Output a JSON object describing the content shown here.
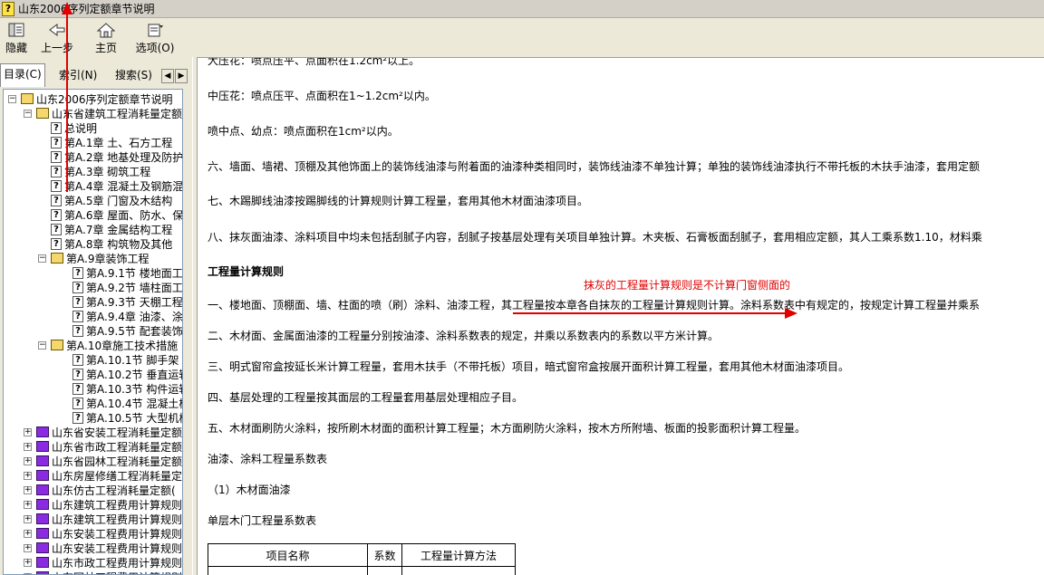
{
  "window": {
    "title": "山东2006序列定额章节说明",
    "app_icon_glyph": "?"
  },
  "toolbar": {
    "hide": "隐藏",
    "back": "上一步",
    "home": "主页",
    "options": "选项(O)"
  },
  "tabs": {
    "contents": "目录(C)",
    "index": "索引(N)",
    "search": "搜索(S)",
    "scroll_left": "◀",
    "scroll_right": "▶"
  },
  "tree": [
    {
      "label": "山东2006序列定额章节说明",
      "icon": "book-open",
      "expander": "−",
      "level": 0
    },
    {
      "label": "山东省建筑工程消耗量定额",
      "icon": "book-open",
      "expander": "−",
      "level": 1
    },
    {
      "label": "总说明",
      "icon": "help-page",
      "level": 2
    },
    {
      "label": "第A.1章 土、石方工程",
      "icon": "help-page",
      "level": 2
    },
    {
      "label": "第A.2章 地基处理及防护",
      "icon": "help-page",
      "level": 2
    },
    {
      "label": "第A.3章 砌筑工程",
      "icon": "help-page",
      "level": 2
    },
    {
      "label": "第A.4章 混凝土及钢筋混凝土",
      "icon": "help-page",
      "level": 2
    },
    {
      "label": "第A.5章 门窗及木结构",
      "icon": "help-page",
      "level": 2
    },
    {
      "label": "第A.6章 屋面、防水、保温",
      "icon": "help-page",
      "level": 2
    },
    {
      "label": "第A.7章 金属结构工程",
      "icon": "help-page",
      "level": 2
    },
    {
      "label": "第A.8章 构筑物及其他",
      "icon": "help-page",
      "level": 2
    },
    {
      "label": "第A.9章装饰工程",
      "icon": "book-open",
      "expander": "−",
      "level": 2
    },
    {
      "label": "第A.9.1节 楼地面工程",
      "icon": "help-page",
      "level": 3
    },
    {
      "label": "第A.9.2节 墙柱面工程",
      "icon": "help-page",
      "level": 3
    },
    {
      "label": "第A.9.3节 天棚工程",
      "icon": "help-page",
      "level": 3
    },
    {
      "label": "第A.9.4章 油漆、涂料",
      "icon": "help-page",
      "level": 3
    },
    {
      "label": "第A.9.5节 配套装饰",
      "icon": "help-page",
      "level": 3
    },
    {
      "label": "第A.10章施工技术措施",
      "icon": "book-open",
      "expander": "−",
      "level": 2
    },
    {
      "label": "第A.10.1节 脚手架",
      "icon": "help-page",
      "level": 3
    },
    {
      "label": "第A.10.2节 垂直运输",
      "icon": "help-page",
      "level": 3
    },
    {
      "label": "第A.10.3节 构件运输",
      "icon": "help-page",
      "level": 3
    },
    {
      "label": "第A.10.4节 混凝土模板",
      "icon": "help-page",
      "level": 3
    },
    {
      "label": "第A.10.5节 大型机械",
      "icon": "help-page",
      "level": 3
    },
    {
      "label": "山东省安装工程消耗量定额",
      "icon": "book-closed",
      "expander": "+",
      "level": 1
    },
    {
      "label": "山东省市政工程消耗量定额",
      "icon": "book-closed",
      "expander": "+",
      "level": 1
    },
    {
      "label": "山东省园林工程消耗量定额",
      "icon": "book-closed",
      "expander": "+",
      "level": 1
    },
    {
      "label": "山东房屋修缮工程消耗量定额",
      "icon": "book-closed",
      "expander": "+",
      "level": 1
    },
    {
      "label": "山东仿古工程消耗量定额(",
      "icon": "book-closed",
      "expander": "+",
      "level": 1
    },
    {
      "label": "山东建筑工程费用计算规则",
      "icon": "book-closed",
      "expander": "+",
      "level": 1
    },
    {
      "label": "山东建筑工程费用计算规则",
      "icon": "book-closed",
      "expander": "+",
      "level": 1
    },
    {
      "label": "山东安装工程费用计算规则",
      "icon": "book-closed",
      "expander": "+",
      "level": 1
    },
    {
      "label": "山东安装工程费用计算规则",
      "icon": "book-closed",
      "expander": "+",
      "level": 1
    },
    {
      "label": "山东市政工程费用计算规则",
      "icon": "book-closed",
      "expander": "+",
      "level": 1
    },
    {
      "label": "山东园林工程费用计算规则",
      "icon": "book-closed",
      "expander": "+",
      "level": 1
    }
  ],
  "content": {
    "paragraphs": [
      {
        "text": "大压花：喷点压平、点面积在1.2cm²以上。",
        "bold": false
      },
      {
        "text": "中压花：喷点压平、点面积在1~1.2cm²以内。",
        "bold": false
      },
      {
        "text": "  喷中点、幼点：喷点面积在1cm²以内。",
        "bold": false
      },
      {
        "text": "六、墙面、墙裙、顶棚及其他饰面上的装饰线油漆与附着面的油漆种类相同时，装饰线油漆不单独计算；单独的装饰线油漆执行不带托板的木扶手油漆，套用定额",
        "bold": false
      },
      {
        "text": "七、木踢脚线油漆按踢脚线的计算规则计算工程量，套用其他木材面油漆项目。",
        "bold": false
      },
      {
        "text": "八、抹灰面油漆、涂料项目中均未包括刮腻子内容，刮腻子按基层处理有关项目单独计算。木夹板、石膏板面刮腻子，套用相应定额，其人工乘系数1.10，材料乘",
        "bold": false
      },
      {
        "text": "工程量计算规则",
        "bold": true
      },
      {
        "text": "  一、楼地面、顶棚面、墙、柱面的喷（刷）涂料、油漆工程，其工程量按本章各自抹灰的工程量计算规则计算。涂料系数表中有规定的，按规定计算工程量并乘系",
        "bold": false
      },
      {
        "text": "  二、木材面、金属面油漆的工程量分别按油漆、涂料系数表的规定，并乘以系数表内的系数以平方米计算。",
        "bold": false
      },
      {
        "text": "  三、明式窗帘盒按延长米计算工程量，套用木扶手（不带托板）项目，暗式窗帘盒按展开面积计算工程量，套用其他木材面油漆项目。",
        "bold": false
      },
      {
        "text": "  四、基层处理的工程量按其面层的工程量套用基层处理相应子目。",
        "bold": false
      },
      {
        "text": "五、木材面刷防火涂料，按所刷木材面的面积计算工程量；木方面刷防火涂料，按木方所附墙、板面的投影面积计算工程量。",
        "bold": false
      },
      {
        "text": "油漆、涂料工程量系数表",
        "bold": false
      },
      {
        "text": "  （1）木材面油漆",
        "bold": false
      },
      {
        "text": "单层木门工程量系数表",
        "bold": false
      }
    ],
    "annotation": "抹灰的工程量计算规则是不计算门窗侧面的",
    "table_headers": [
      "项目名称",
      "系数",
      "工程量计算方法"
    ],
    "annotation_color": "#e00000"
  }
}
